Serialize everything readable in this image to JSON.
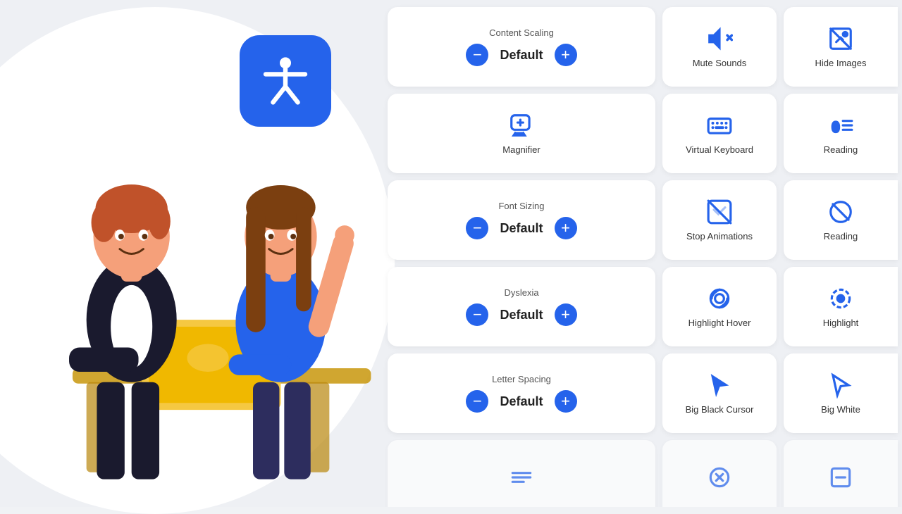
{
  "background": {
    "color": "#f0f2f5"
  },
  "accessibility_icon": {
    "label": "Accessibility Widget Icon",
    "bg_color": "#2563EB"
  },
  "widgets": {
    "content_scaling": {
      "title": "Content Scaling",
      "value": "Default",
      "decrease_label": "−",
      "increase_label": "+"
    },
    "mute_sounds": {
      "label": "Mute Sounds"
    },
    "hide_images": {
      "label": "Hide Images"
    },
    "magnifier": {
      "label": "Magnifier"
    },
    "virtual_keyboard": {
      "label": "Virtual Keyboard"
    },
    "reading_guide": {
      "label": "Reading"
    },
    "font_sizing": {
      "title": "Font Sizing",
      "value": "Default"
    },
    "stop_animations": {
      "label": "Stop Animations"
    },
    "reading_mask": {
      "label": "Reading"
    },
    "dyslexia": {
      "title": "Dyslexia",
      "value": "Default"
    },
    "highlight_hover": {
      "label": "Highlight Hover"
    },
    "highlight_focus": {
      "label": "Highlight"
    },
    "letter_spacing": {
      "title": "Letter Spacing",
      "value": "Default"
    },
    "big_black_cursor": {
      "label": "Big Black Cursor"
    },
    "big_white_cursor": {
      "label": "Big White"
    }
  }
}
